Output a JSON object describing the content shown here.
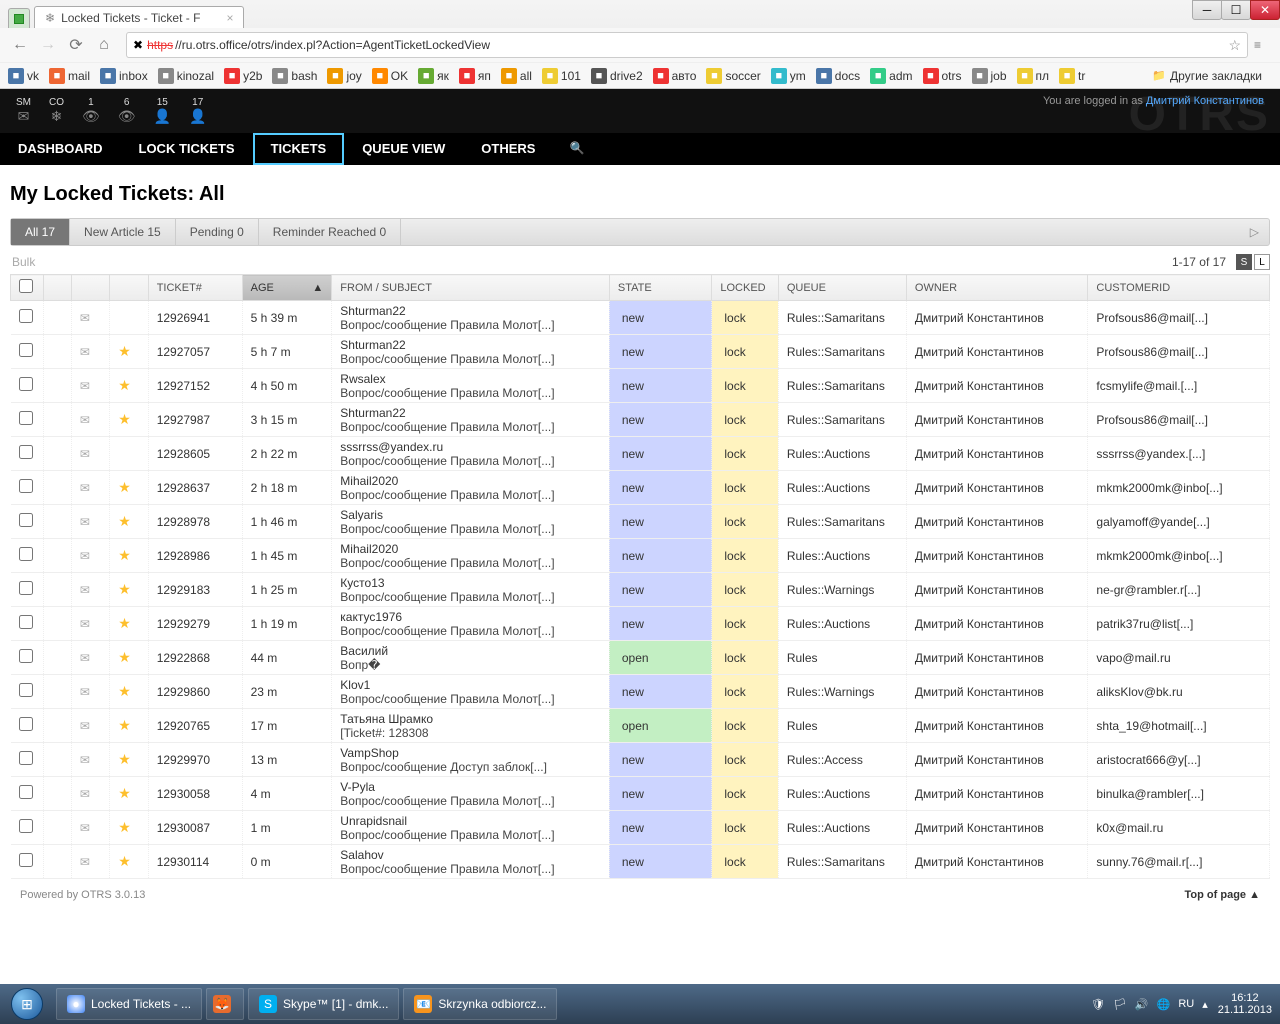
{
  "browser": {
    "tab_title": "Locked Tickets - Ticket - F",
    "url_proto": "https",
    "url": "//ru.otrs.office/otrs/index.pl?Action=AgentTicketLockedView"
  },
  "bookmarks": [
    "vk",
    "mail",
    "inbox",
    "kinozal",
    "y2b",
    "bash",
    "joy",
    "OK",
    "як",
    "яп",
    "all",
    "101",
    "drive2",
    "авто",
    "soccer",
    "ym",
    "docs",
    "adm",
    "otrs",
    "job",
    "пл",
    "tr"
  ],
  "bookmarks_other": "Другие закладки",
  "otrs": {
    "stats": [
      {
        "label": "SM",
        "val": "",
        "icon": "✉"
      },
      {
        "label": "CO",
        "val": "",
        "icon": "❄"
      },
      {
        "label": "",
        "val": "1",
        "icon": "👁"
      },
      {
        "label": "",
        "val": "6",
        "icon": "👁"
      },
      {
        "label": "",
        "val": "15",
        "icon": "👤"
      },
      {
        "label": "",
        "val": "17",
        "icon": "👤"
      }
    ],
    "logged_text": "You are logged in as ",
    "logged_user": "Дмитрий Константинов",
    "watermark": "OTRS"
  },
  "nav": [
    "DASHBOARD",
    "LOCK TICKETS",
    "TICKETS",
    "QUEUE VIEW",
    "OTHERS"
  ],
  "nav_active": 2,
  "page_title": "My Locked Tickets: All",
  "filters": [
    {
      "label": "All 17",
      "active": true
    },
    {
      "label": "New Article 15"
    },
    {
      "label": "Pending 0"
    },
    {
      "label": "Reminder Reached 0"
    }
  ],
  "bulk_label": "Bulk",
  "pager": "1-17 of 17",
  "columns": [
    "",
    "",
    "",
    "",
    "TICKET#",
    "AGE",
    "FROM / SUBJECT",
    "STATE",
    "LOCKED",
    "QUEUE",
    "OWNER",
    "CUSTOMERID"
  ],
  "sorted_col": "AGE",
  "rows": [
    {
      "star": false,
      "ticket": "12926941",
      "age": "5 h 39 m",
      "from": "Shturman22",
      "subject": "Вопрос/сообщение Правила Молот[...]",
      "state": "new",
      "locked": "lock",
      "queue": "Rules::Samaritans",
      "owner": "Дмитрий Константинов",
      "cust": "Profsous86@mail[...]"
    },
    {
      "star": true,
      "ticket": "12927057",
      "age": "5 h 7 m",
      "from": "Shturman22",
      "subject": "Вопрос/сообщение Правила Молот[...]",
      "state": "new",
      "locked": "lock",
      "queue": "Rules::Samaritans",
      "owner": "Дмитрий Константинов",
      "cust": "Profsous86@mail[...]"
    },
    {
      "star": true,
      "ticket": "12927152",
      "age": "4 h 50 m",
      "from": "Rwsalex",
      "subject": "Вопрос/сообщение Правила Молот[...]",
      "state": "new",
      "locked": "lock",
      "queue": "Rules::Samaritans",
      "owner": "Дмитрий Константинов",
      "cust": "fcsmylife@mail.[...]"
    },
    {
      "star": true,
      "ticket": "12927987",
      "age": "3 h 15 m",
      "from": "Shturman22",
      "subject": "Вопрос/сообщение Правила Молот[...]",
      "state": "new",
      "locked": "lock",
      "queue": "Rules::Samaritans",
      "owner": "Дмитрий Константинов",
      "cust": "Profsous86@mail[...]"
    },
    {
      "star": false,
      "ticket": "12928605",
      "age": "2 h 22 m",
      "from": "sssrrss@yandex.ru",
      "subject": "Вопрос/сообщение Правила Молот[...]",
      "state": "new",
      "locked": "lock",
      "queue": "Rules::Auctions",
      "owner": "Дмитрий Константинов",
      "cust": "sssrrss@yandex.[...]"
    },
    {
      "star": true,
      "ticket": "12928637",
      "age": "2 h 18 m",
      "from": "Mihail2020",
      "subject": "Вопрос/сообщение Правила Молот[...]",
      "state": "new",
      "locked": "lock",
      "queue": "Rules::Auctions",
      "owner": "Дмитрий Константинов",
      "cust": "mkmk2000mk@inbo[...]"
    },
    {
      "star": true,
      "ticket": "12928978",
      "age": "1 h 46 m",
      "from": "Salyaris",
      "subject": "Вопрос/сообщение Правила Молот[...]",
      "state": "new",
      "locked": "lock",
      "queue": "Rules::Samaritans",
      "owner": "Дмитрий Константинов",
      "cust": "galyamoff@yande[...]"
    },
    {
      "star": true,
      "ticket": "12928986",
      "age": "1 h 45 m",
      "from": "Mihail2020",
      "subject": "Вопрос/сообщение Правила Молот[...]",
      "state": "new",
      "locked": "lock",
      "queue": "Rules::Auctions",
      "owner": "Дмитрий Константинов",
      "cust": "mkmk2000mk@inbo[...]"
    },
    {
      "star": true,
      "ticket": "12929183",
      "age": "1 h 25 m",
      "from": "Кусто13",
      "subject": "Вопрос/сообщение Правила Молот[...]",
      "state": "new",
      "locked": "lock",
      "queue": "Rules::Warnings",
      "owner": "Дмитрий Константинов",
      "cust": "ne-gr@rambler.r[...]"
    },
    {
      "star": true,
      "ticket": "12929279",
      "age": "1 h 19 m",
      "from": "кактус1976",
      "subject": "Вопрос/сообщение Правила Молот[...]",
      "state": "new",
      "locked": "lock",
      "queue": "Rules::Auctions",
      "owner": "Дмитрий Константинов",
      "cust": "patrik37ru@list[...]"
    },
    {
      "star": true,
      "ticket": "12922868",
      "age": "44 m",
      "from": "Василий",
      "subject": "Вопр�",
      "state": "open",
      "locked": "lock",
      "queue": "Rules",
      "owner": "Дмитрий Константинов",
      "cust": "vapo@mail.ru"
    },
    {
      "star": true,
      "ticket": "12929860",
      "age": "23 m",
      "from": "Klov1",
      "subject": "Вопрос/сообщение Правила Молот[...]",
      "state": "new",
      "locked": "lock",
      "queue": "Rules::Warnings",
      "owner": "Дмитрий Константинов",
      "cust": "aliksKlov@bk.ru"
    },
    {
      "star": true,
      "ticket": "12920765",
      "age": "17 m",
      "from": "Татьяна Шрамко",
      "subject": "[Ticket#: 128308",
      "state": "open",
      "locked": "lock",
      "queue": "Rules",
      "owner": "Дмитрий Константинов",
      "cust": "shta_19@hotmail[...]"
    },
    {
      "star": true,
      "ticket": "12929970",
      "age": "13 m",
      "from": "VampShop",
      "subject": "Вопрос/сообщение Доступ заблок[...]",
      "state": "new",
      "locked": "lock",
      "queue": "Rules::Access",
      "owner": "Дмитрий Константинов",
      "cust": "aristocrat666@y[...]"
    },
    {
      "star": true,
      "ticket": "12930058",
      "age": "4 m",
      "from": "V-Pyla",
      "subject": "Вопрос/сообщение Правила Молот[...]",
      "state": "new",
      "locked": "lock",
      "queue": "Rules::Auctions",
      "owner": "Дмитрий Константинов",
      "cust": "binulka@rambler[...]"
    },
    {
      "star": true,
      "ticket": "12930087",
      "age": "1 m",
      "from": "Unrapidsnail",
      "subject": "Вопрос/сообщение Правила Молот[...]",
      "state": "new",
      "locked": "lock",
      "queue": "Rules::Auctions",
      "owner": "Дмитрий Константинов",
      "cust": "k0x@mail.ru"
    },
    {
      "star": true,
      "ticket": "12930114",
      "age": "0 m",
      "from": "Salahov",
      "subject": "Вопрос/сообщение Правила Молот[...]",
      "state": "new",
      "locked": "lock",
      "queue": "Rules::Samaritans",
      "owner": "Дмитрий Константинов",
      "cust": "sunny.76@mail.r[...]"
    }
  ],
  "footer": {
    "powered": "Powered by OTRS 3.0.13",
    "top": "Top of page"
  },
  "taskbar": {
    "items": [
      {
        "label": "Locked Tickets - ...",
        "color": "#fff"
      },
      {
        "label": "",
        "color": "#e66b2e",
        "icon": "🦊"
      },
      {
        "label": "Skype™ [1] - dmk...",
        "color": "#fff",
        "icon": "S"
      },
      {
        "label": "Skrzynka odbiorcz...",
        "color": "#fff",
        "icon": "📧"
      }
    ],
    "lang": "RU",
    "time": "16:12",
    "date": "21.11.2013"
  }
}
